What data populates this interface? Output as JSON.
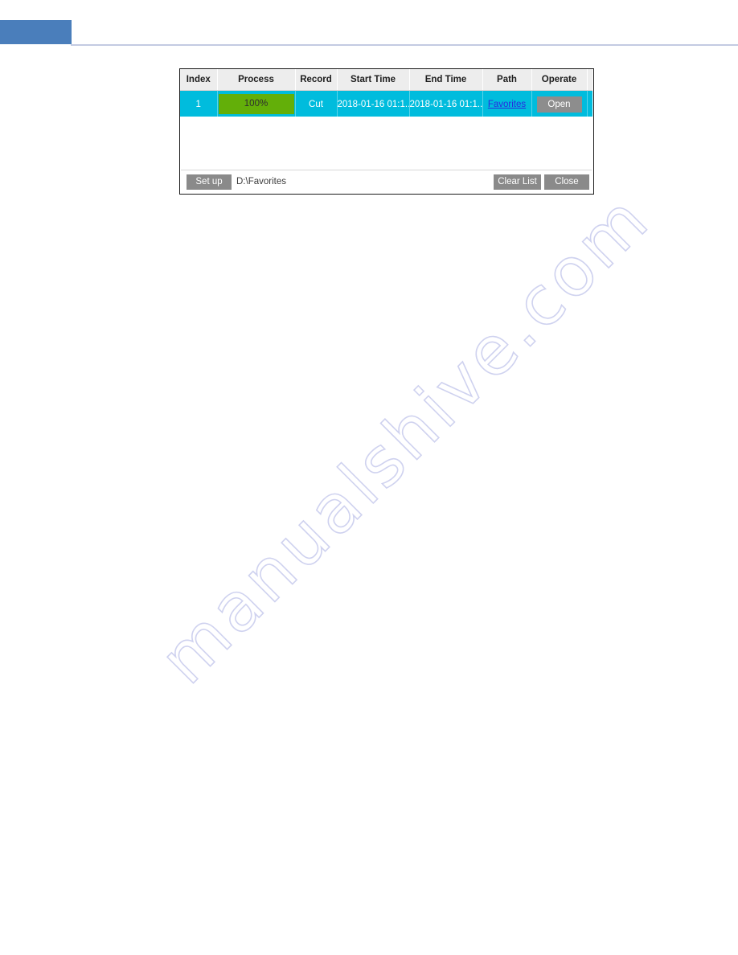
{
  "page": {
    "header_accent_color": "#4a7ebb",
    "divider_color": "#c3cbe2",
    "watermark_text": "manualshive.com"
  },
  "dialog": {
    "name": "backup-task-list",
    "table": {
      "columns": [
        "Index",
        "Process",
        "Record",
        "Start Time",
        "End Time",
        "Path",
        "Operate"
      ],
      "rows": [
        {
          "index": "1",
          "process_label": "100%",
          "process_percent": 100,
          "record": "Cut",
          "start_time": "2018-01-16 01:1...",
          "end_time": "2018-01-16 01:1...",
          "path_link": "Favorites",
          "operate_button": "Open"
        }
      ]
    },
    "footer": {
      "setup_label": "Set up",
      "path_value": "D:\\Favorites",
      "clear_list_label": "Clear List",
      "close_label": "Close"
    },
    "colors": {
      "row_selected": "#00bcdd",
      "progress_fill": "#63af09",
      "header_bg": "#ededed",
      "button_bg": "#8a8a8a",
      "link": "#2a2adf"
    }
  }
}
